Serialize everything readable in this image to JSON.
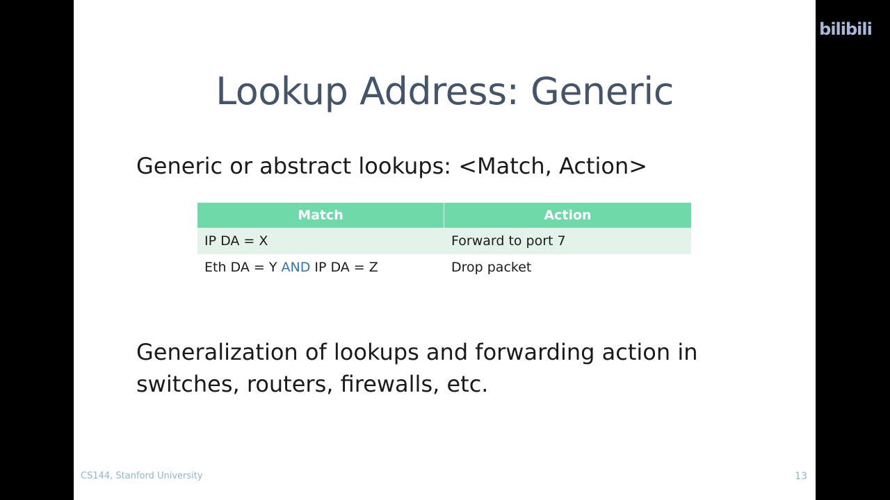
{
  "watermark": "bilibili",
  "slide": {
    "title": "Lookup Address: Generic",
    "line1": "Generic or abstract lookups: <Match, Action>",
    "table": {
      "headers": [
        "Match",
        "Action"
      ],
      "rows": [
        {
          "match": "IP DA = X",
          "action": "Forward to port 7"
        },
        {
          "match_pre": "Eth DA = Y ",
          "match_kw": "AND",
          "match_post": " IP DA = Z",
          "action": "Drop packet"
        }
      ]
    },
    "paragraph": "Generalization of lookups and forwarding action in switches, routers, firewalls, etc.",
    "footer": "CS144, Stanford University",
    "page_number": "13"
  },
  "colors": {
    "title": "#44546a",
    "table_header": "#6fd9a9",
    "row_alt": "#e4f3ea",
    "keyword": "#2f75b5",
    "footer": "#8ab6d6"
  }
}
